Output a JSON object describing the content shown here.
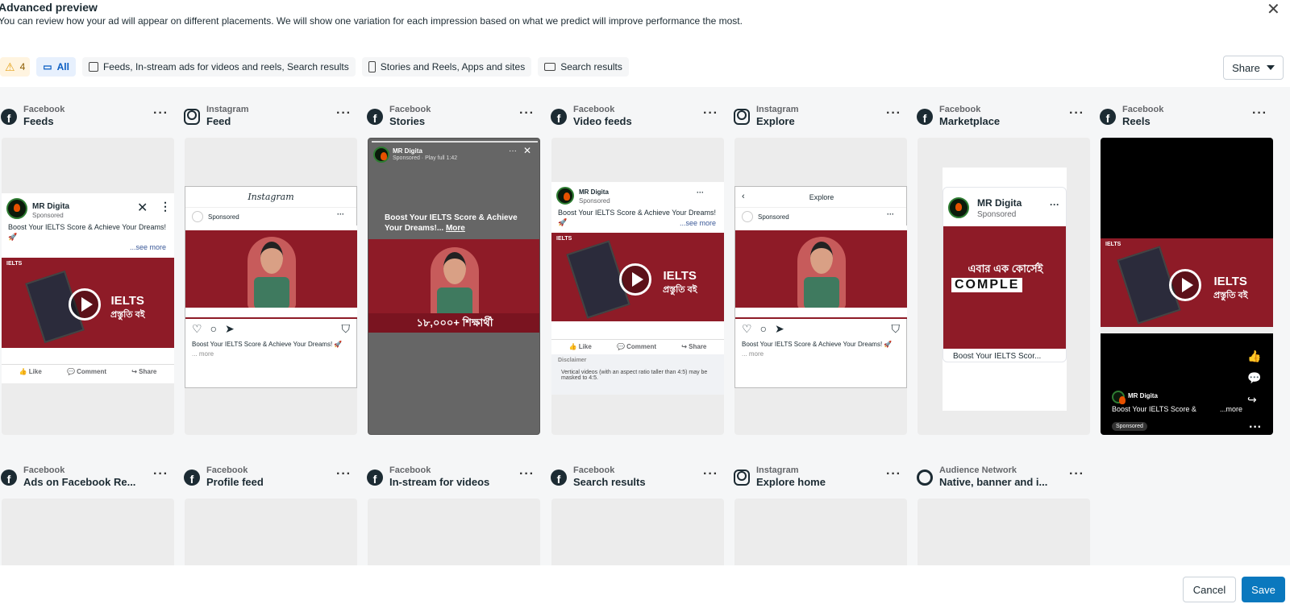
{
  "header": {
    "title": "Advanced preview",
    "subtitle": "You can review how your ad will appear on different placements. We will show one variation for each impression based on what we predict will improve performance the most.",
    "close_icon": "close-icon"
  },
  "filters": {
    "warning_count": "4",
    "all_label": "All",
    "feeds_label": "Feeds, In-stream ads for videos and reels, Search results",
    "stories_label": "Stories and Reels, Apps and sites",
    "search_label": "Search results"
  },
  "share_label": "Share",
  "tiles_row1": [
    {
      "platform": "Facebook",
      "placement": "Feeds"
    },
    {
      "platform": "Instagram",
      "placement": "Feed"
    },
    {
      "platform": "Facebook",
      "placement": "Stories"
    },
    {
      "platform": "Facebook",
      "placement": "Video feeds"
    },
    {
      "platform": "Instagram",
      "placement": "Explore"
    },
    {
      "platform": "Facebook",
      "placement": "Marketplace"
    },
    {
      "platform": "Facebook",
      "placement": "Reels"
    }
  ],
  "tiles_row2": [
    {
      "platform": "Facebook",
      "placement": "Ads on Facebook Re..."
    },
    {
      "platform": "Facebook",
      "placement": "Profile feed"
    },
    {
      "platform": "Facebook",
      "placement": "In-stream for videos"
    },
    {
      "platform": "Facebook",
      "placement": "Search results"
    },
    {
      "platform": "Instagram",
      "placement": "Explore home"
    },
    {
      "platform": "Audience Network",
      "placement": "Native, banner and i..."
    }
  ],
  "ad": {
    "page_name": "MR Digita",
    "sponsored": "Sponsored",
    "sponsored_play": "Sponsored · Play full 1:42",
    "primary_text": "Boost Your IELTS Score & Achieve Your Dreams! 🚀",
    "primary_text_short": "Boost Your IELTS Score & Achieve Your Dreams!...",
    "more": "More",
    "see_more": "...see more",
    "ig_more": "... more",
    "ig_caption": "Boost Your IELTS Score & Achieve Your Dreams! 🚀",
    "ig_logo": "Instagram",
    "explore_title": "Explore",
    "like": "Like",
    "comment": "Comment",
    "share": "Share",
    "disclaimer_title": "Disclaimer",
    "disclaimer_text": "Vertical videos (with an aspect ratio taller than 4:5) may be masked to 4:5.",
    "creative_ielts": "IELTS",
    "creative_bangla": "প্রস্তুতি বই",
    "creative_count": "১৮,০০০+ শিক্ষার্থী",
    "marketplace_bangla": "এবার এক কোর্সেই",
    "marketplace_comple": "COMPLE",
    "marketplace_title": "Boost Your IELTS Scor...",
    "reels_text": "Boost Your IELTS Score &",
    "reels_more": "...more",
    "ielts_tag": "IELTS"
  },
  "footer": {
    "cancel_label": "Cancel",
    "save_label": "Save"
  }
}
